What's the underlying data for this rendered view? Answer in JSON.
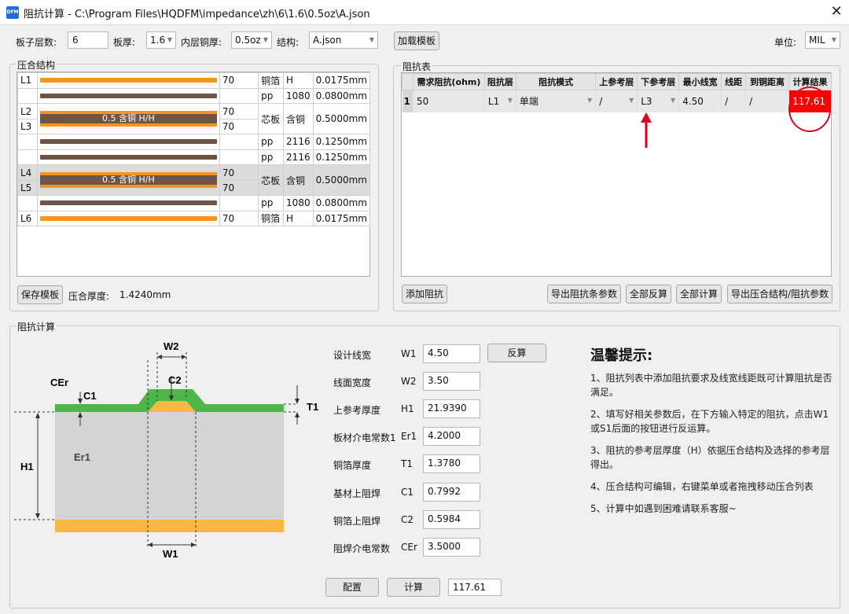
{
  "window": {
    "title": "阻抗计算 - C:\\Program Files\\HQDFM\\impedance\\zh\\6\\1.6\\0.5oz\\A.json",
    "icon_text": "DFM",
    "close": "✕"
  },
  "toolbar": {
    "layers_label": "板子层数:",
    "layers_value": "6",
    "thick_label": "板厚:",
    "thick_value": "1.6",
    "inner_label": "内层铜厚:",
    "inner_value": "0.5oz",
    "struct_label": "结构:",
    "struct_value": "A.json",
    "load_btn": "加载模板",
    "unit_label": "单位:",
    "unit_value": "MIL"
  },
  "stackup": {
    "title": "压合结构",
    "rows": [
      {
        "layer": "L1",
        "kind": "foil",
        "n": "70",
        "type": "铜箔",
        "spec": "H",
        "thick": "0.0175mm"
      },
      {
        "layer": "",
        "kind": "pp",
        "n": "",
        "type": "pp",
        "spec": "1080",
        "thick": "0.0800mm"
      },
      {
        "layer": "L2",
        "layer2": "L3",
        "kind": "core",
        "core_label": "0.5 含铜 H/H",
        "n": "70",
        "n2": "70",
        "type": "芯板",
        "spec": "含铜",
        "thick": "0.5000mm"
      },
      {
        "layer": "",
        "kind": "pp",
        "n": "",
        "type": "pp",
        "spec": "2116",
        "thick": "0.1250mm"
      },
      {
        "layer": "",
        "kind": "pp",
        "n": "",
        "type": "pp",
        "spec": "2116",
        "thick": "0.1250mm"
      },
      {
        "layer": "L4",
        "layer2": "L5",
        "kind": "core",
        "core_label": "0.5 含铜 H/H",
        "n": "70",
        "n2": "70",
        "type": "芯板",
        "spec": "含铜",
        "thick": "0.5000mm"
      },
      {
        "layer": "",
        "kind": "pp",
        "n": "",
        "type": "pp",
        "spec": "1080",
        "thick": "0.0800mm"
      },
      {
        "layer": "L6",
        "kind": "foil",
        "n": "70",
        "type": "铜箔",
        "spec": "H",
        "thick": "0.0175mm"
      }
    ],
    "save_btn": "保存模板",
    "total_label": "压合厚度:",
    "total_value": "1.4240mm"
  },
  "imptable": {
    "title": "阻抗表",
    "headers": [
      "需求阻抗(ohm)",
      "阻抗层",
      "阻抗模式",
      "上参考层",
      "下参考层",
      "最小线宽",
      "线距",
      "到铜距离",
      "计算结果"
    ],
    "row": {
      "idx": "1",
      "req": "50",
      "layer": "L1",
      "mode": "单端",
      "upper": "/",
      "lower": "L3",
      "minw": "4.50",
      "space": "/",
      "dist": "/",
      "result": "117.61"
    },
    "add_btn": "添加阻抗",
    "export_btn": "导出阻抗条参数",
    "reverse_all_btn": "全部反算",
    "calc_all_btn": "全部计算",
    "export2_btn": "导出压合结构/阻抗参数"
  },
  "calc": {
    "title": "阻抗计算",
    "diagram": {
      "w2": "W2",
      "cer": "CEr",
      "c1": "C1",
      "c2": "C2",
      "t1": "T1",
      "h1": "H1",
      "er1": "Er1",
      "w1": "W1"
    },
    "params": [
      {
        "label": "设计线宽",
        "sym": "W1",
        "value": "4.50"
      },
      {
        "label": "线面宽度",
        "sym": "W2",
        "value": "3.50"
      },
      {
        "label": "上参考厚度",
        "sym": "H1",
        "value": "21.9390"
      },
      {
        "label": "板材介电常数1",
        "sym": "Er1",
        "value": "4.2000"
      },
      {
        "label": "铜箔厚度",
        "sym": "T1",
        "value": "1.3780"
      },
      {
        "label": "基材上阻焊",
        "sym": "C1",
        "value": "0.7992"
      },
      {
        "label": "铜箔上阻焊",
        "sym": "C2",
        "value": "0.5984"
      },
      {
        "label": "阻焊介电常数",
        "sym": "CEr",
        "value": "3.5000"
      }
    ],
    "reverse_btn": "反算",
    "config_btn": "配置",
    "calc_btn": "计算",
    "result_value": "117.61",
    "tips_title": "温馨提示:",
    "tips": [
      "1、阻抗列表中添加阻抗要求及线宽线距既可计算阻抗是否满足。",
      "2、填写好相关参数后，在下方输入特定的阻抗，点击W1或S1后面的按钮进行反运算。",
      "3、阻抗的参考层厚度（H）依据压合结构及选择的参考层得出。",
      "4、压合结构可编辑，右键菜单或者拖拽移动压合列表",
      "5、计算中如遇到困难请联系客服~"
    ]
  },
  "colors": {
    "copper": "#f7941d",
    "core": "#6e5446",
    "mask": "#4cb748",
    "result_bg": "#ff0000",
    "arrow": "#e0001b"
  }
}
